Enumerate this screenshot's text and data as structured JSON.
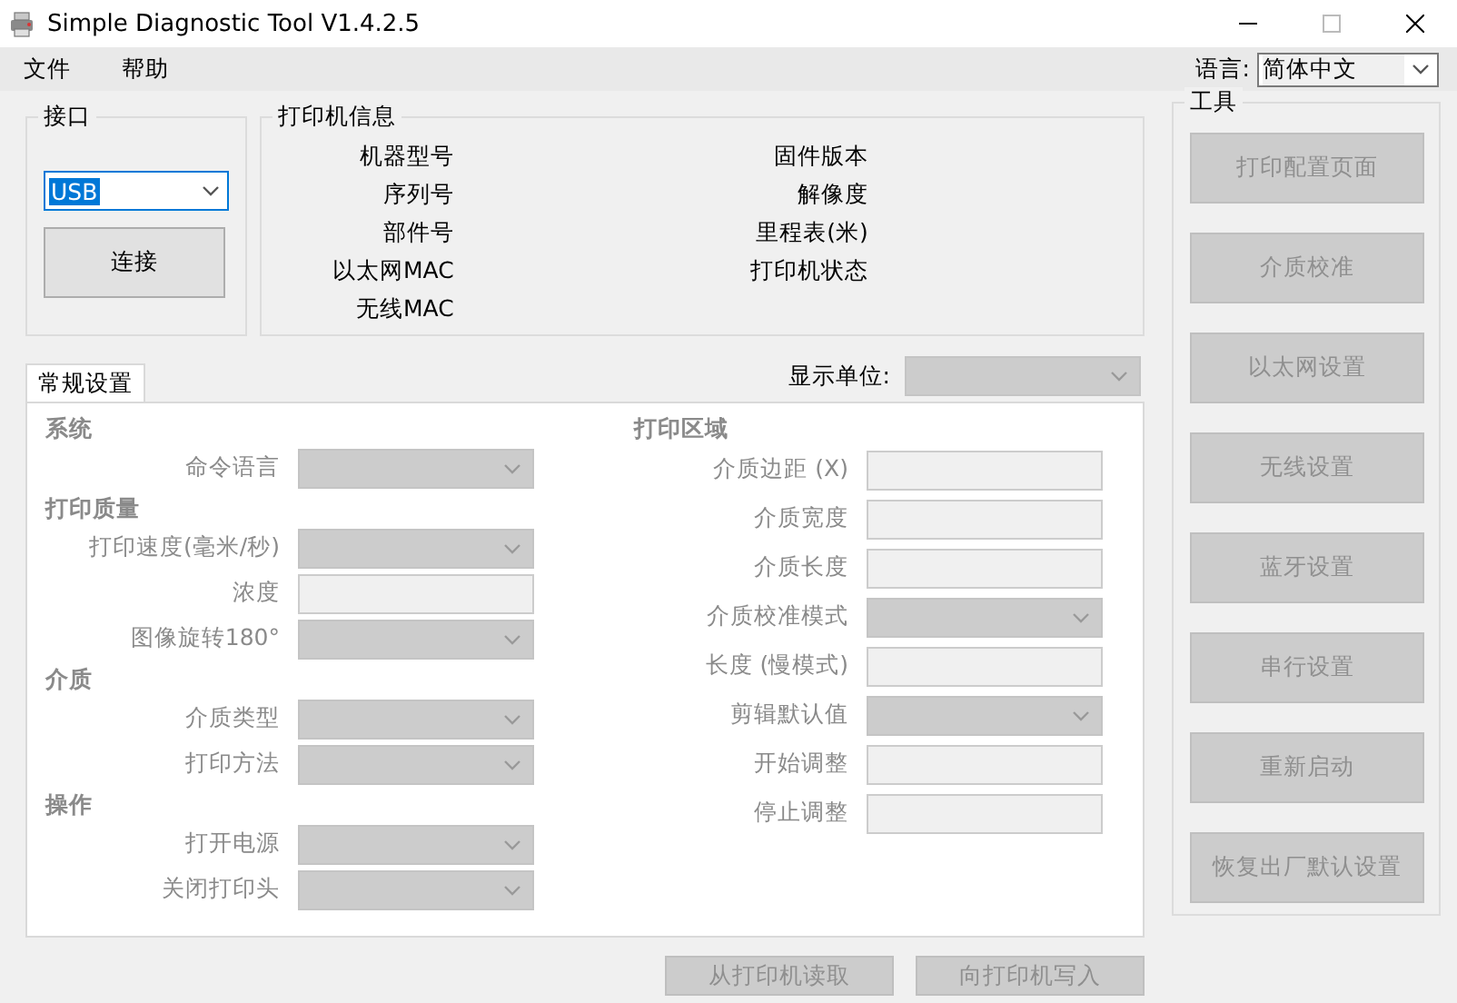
{
  "window": {
    "title": "Simple Diagnostic Tool V1.4.2.5"
  },
  "menu": [
    {
      "label": "文件"
    },
    {
      "label": "帮助"
    }
  ],
  "language": {
    "label": "语言:",
    "value": "简体中文"
  },
  "interface": {
    "title": "接口",
    "port": {
      "value": "USB",
      "highlighted": true
    },
    "connect_button": {
      "label": "连接",
      "disabled": false
    }
  },
  "printer_info": {
    "title": "打印机信息",
    "fields_left": [
      "机器型号",
      "序列号",
      "部件号",
      "以太网MAC",
      "无线MAC"
    ],
    "fields_right": [
      "固件版本",
      "解像度",
      "里程表(米)",
      "打印机状态"
    ]
  },
  "tabs": [
    {
      "label": "常规设置",
      "selected": true
    }
  ],
  "display_unit": {
    "label": "显示单位:",
    "disabled": true
  },
  "settings_left": [
    {
      "title": "系统",
      "rows": [
        {
          "label": "命令语言",
          "kind": "select",
          "disabled": true
        }
      ]
    },
    {
      "title": "打印质量",
      "rows": [
        {
          "label": "打印速度(毫米/秒)",
          "kind": "select",
          "disabled": true
        },
        {
          "label": "浓度",
          "kind": "input",
          "disabled": true
        },
        {
          "label": "图像旋转180°",
          "kind": "select",
          "disabled": true
        }
      ]
    },
    {
      "title": "介质",
      "rows": [
        {
          "label": "介质类型",
          "kind": "select",
          "disabled": true
        },
        {
          "label": "打印方法",
          "kind": "select",
          "disabled": true
        }
      ]
    },
    {
      "title": "操作",
      "rows": [
        {
          "label": "打开电源",
          "kind": "select",
          "disabled": true
        },
        {
          "label": "关闭打印头",
          "kind": "select",
          "disabled": true
        }
      ]
    }
  ],
  "settings_right": [
    {
      "title": "打印区域",
      "rows": [
        {
          "label": "介质边距 (X)",
          "kind": "input",
          "disabled": true
        },
        {
          "label": "介质宽度",
          "kind": "input",
          "disabled": true
        },
        {
          "label": "介质长度",
          "kind": "input",
          "disabled": true
        },
        {
          "label": "介质校准模式",
          "kind": "select",
          "disabled": true
        },
        {
          "label": "长度 (慢模式)",
          "kind": "input",
          "disabled": true
        },
        {
          "label": "剪辑默认值",
          "kind": "select",
          "disabled": true
        },
        {
          "label": "开始调整",
          "kind": "input",
          "disabled": true
        },
        {
          "label": "停止调整",
          "kind": "input",
          "disabled": true
        }
      ]
    }
  ],
  "actions": [
    {
      "label": "从打印机读取",
      "disabled": true
    },
    {
      "label": "向打印机写入",
      "disabled": true
    }
  ],
  "tools": {
    "title": "工具",
    "buttons": [
      {
        "label": "打印配置页面",
        "disabled": true
      },
      {
        "label": "介质校准",
        "disabled": true
      },
      {
        "label": "以太网设置",
        "disabled": true
      },
      {
        "label": "无线设置",
        "disabled": true
      },
      {
        "label": "蓝牙设置",
        "disabled": true
      },
      {
        "label": "串行设置",
        "disabled": true
      },
      {
        "label": "重新启动",
        "disabled": true
      },
      {
        "label": "恢复出厂默认设置",
        "disabled": true
      }
    ]
  }
}
